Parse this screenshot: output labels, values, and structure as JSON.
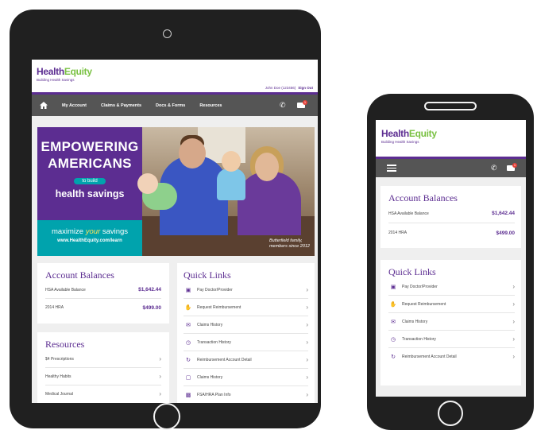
{
  "brand": {
    "logo_health": "Health",
    "logo_equity": "Equity",
    "tagline": "Building Health Savings",
    "purple": "#5c2d91",
    "green": "#7ac143",
    "teal": "#00a3ad"
  },
  "tablet": {
    "user": "John Doe (123456)",
    "signout": "Sign Out",
    "nav": [
      "My Account",
      "Claims & Payments",
      "Docs & Forms",
      "Resources"
    ],
    "mail_badge": "1",
    "hero": {
      "line1": "EMPOWERING",
      "line2": "AMERICANS",
      "mid": "to build",
      "line3": "health savings",
      "max_pre": "maximize ",
      "max_your": "your",
      "max_post": " savings",
      "url": "www.HealthEquity.com/learn",
      "caption1": "Butterfield family,",
      "caption2": "members since 2012"
    },
    "account_balances": {
      "title": "Account Balances",
      "rows": [
        {
          "label": "HSA Available Balance",
          "value": "$1,642.44"
        },
        {
          "label": "2014 HRA",
          "value": "$499.00"
        }
      ]
    },
    "resources": {
      "title": "Resources",
      "items": [
        "$4 Prescriptions",
        "Healthy Habits",
        "Medical Journal"
      ]
    },
    "quick_links": {
      "title": "Quick Links",
      "items": [
        {
          "label": "Pay Doctor/Provider",
          "icon": "money-icon"
        },
        {
          "label": "Request Reimbursement",
          "icon": "hand-money-icon"
        },
        {
          "label": "Claims History",
          "icon": "claims-icon"
        },
        {
          "label": "Transaction History",
          "icon": "clock-icon"
        },
        {
          "label": "Reimbursement Account Detail",
          "icon": "dollar-cycle-icon"
        },
        {
          "label": "Claims History",
          "icon": "folder-icon"
        },
        {
          "label": "FSA/HRA Plan Info",
          "icon": "chart-icon"
        }
      ]
    }
  },
  "phone": {
    "mail_badge": "1",
    "account_balances": {
      "title": "Account Balances",
      "rows": [
        {
          "label": "HSA Available Balance",
          "value": "$1,642.44"
        },
        {
          "label": "2014 HRA",
          "value": "$499.00"
        }
      ]
    },
    "quick_links": {
      "title": "Quick Links",
      "items": [
        {
          "label": "Pay Doctor/Provider",
          "icon": "money-icon"
        },
        {
          "label": "Request Reimbursement",
          "icon": "hand-money-icon"
        },
        {
          "label": "Claims History",
          "icon": "claims-icon"
        },
        {
          "label": "Transaction History",
          "icon": "clock-icon"
        },
        {
          "label": "Reimbursement Account Detail",
          "icon": "dollar-cycle-icon"
        }
      ]
    }
  }
}
